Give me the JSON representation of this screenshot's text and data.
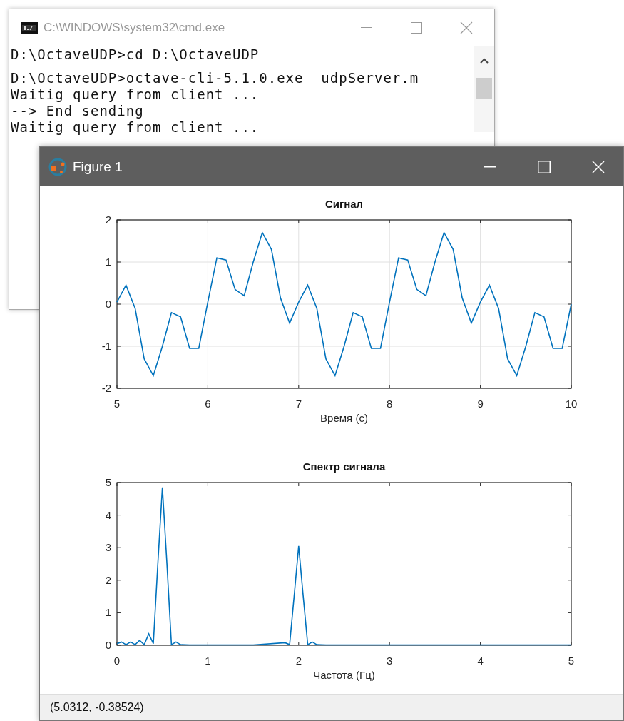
{
  "console_window": {
    "title": "C:\\WINDOWS\\system32\\cmd.exe",
    "blocks": [
      {
        "lines": [
          "D:\\OctaveUDP>cd D:\\OctaveUDP"
        ]
      },
      {
        "lines": [
          "D:\\OctaveUDP>octave-cli-5.1.0.exe _udpServer.m",
          "Waitig query from client ...",
          "--> End sending",
          "Waitig query from client ..."
        ]
      }
    ]
  },
  "figure_window": {
    "title": "Figure 1",
    "charts": [
      {
        "chart_data": {
          "type": "line",
          "title": "Сигнал",
          "xlabel": "Время (с)",
          "grid": true,
          "xlim": [
            5,
            10
          ],
          "ylim": [
            -2,
            2
          ],
          "xticks": [
            5,
            6,
            7,
            8,
            9,
            10
          ],
          "yticks": [
            -2,
            -1,
            0,
            1,
            2
          ],
          "x": [
            5,
            5.1,
            5.2,
            5.3,
            5.4,
            5.5,
            5.6,
            5.7,
            5.8,
            5.9,
            6,
            6.1,
            6.2,
            6.3,
            6.4,
            6.5,
            6.6,
            6.7,
            6.8,
            6.9,
            7,
            7.1,
            7.2,
            7.3,
            7.4,
            7.5,
            7.6,
            7.7,
            7.8,
            7.9,
            8,
            8.1,
            8.2,
            8.3,
            8.4,
            8.5,
            8.6,
            8.7,
            8.8,
            8.9,
            9,
            9.1,
            9.2,
            9.3,
            9.4,
            9.5,
            9.6,
            9.7,
            9.8,
            9.9,
            10
          ],
          "series": [
            {
              "color": "#0072bd",
              "values": [
                0.05,
                0.45,
                -0.1,
                -1.3,
                -1.7,
                -1.0,
                -0.2,
                -0.3,
                -1.05,
                -1.05,
                0.05,
                1.1,
                1.05,
                0.35,
                0.2,
                1.0,
                1.7,
                1.3,
                0.15,
                -0.45,
                0.05,
                0.45,
                -0.1,
                -1.3,
                -1.7,
                -1.0,
                -0.2,
                -0.3,
                -1.05,
                -1.05,
                0.05,
                1.1,
                1.05,
                0.35,
                0.2,
                1.0,
                1.7,
                1.3,
                0.15,
                -0.45,
                0.05,
                0.45,
                -0.1,
                -1.3,
                -1.7,
                -1.0,
                -0.2,
                -0.3,
                -1.05,
                -1.05,
                0.0
              ]
            }
          ]
        }
      },
      {
        "chart_data": {
          "type": "line",
          "title": "Спектр сигнала",
          "xlabel": "Частота (Гц)",
          "grid": false,
          "xlim": [
            0,
            5
          ],
          "ylim": [
            0,
            5
          ],
          "xticks": [
            0,
            1,
            2,
            3,
            4,
            5
          ],
          "yticks": [
            0,
            1,
            2,
            3,
            4,
            5
          ],
          "x": [
            0,
            0.05,
            0.1,
            0.15,
            0.2,
            0.25,
            0.3,
            0.35,
            0.4,
            0.45,
            0.5,
            0.55,
            0.6,
            0.65,
            0.7,
            0.8,
            1,
            1.5,
            1.85,
            1.9,
            1.95,
            2,
            2.05,
            2.1,
            2.15,
            2.2,
            2.3,
            3,
            4,
            5
          ],
          "series": [
            {
              "color": "#0072bd",
              "values": [
                0.05,
                0.1,
                0.02,
                0.1,
                0.02,
                0.15,
                0.02,
                0.35,
                0.05,
                2.5,
                4.85,
                2.5,
                0.02,
                0.1,
                0.02,
                0.01,
                0.01,
                0.01,
                0.08,
                0.02,
                1.5,
                3.05,
                1.5,
                0.02,
                0.1,
                0.02,
                0.01,
                0.01,
                0.01,
                0.01
              ]
            }
          ]
        }
      }
    ],
    "status_bar": "(5.0312, -0.38524)"
  }
}
